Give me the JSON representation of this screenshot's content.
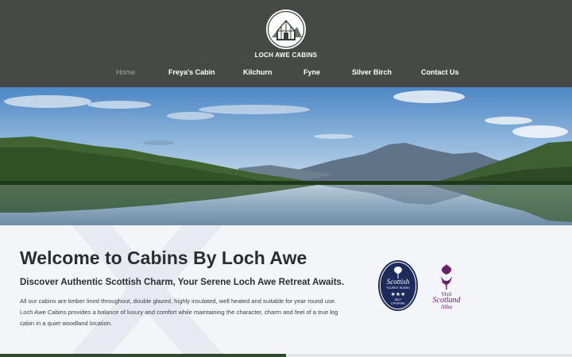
{
  "brand": {
    "name": "LOCH AWE CABINS",
    "logo_icon": "cabin-mountain-logo-icon"
  },
  "nav": {
    "items": [
      {
        "label": "Home",
        "active": true
      },
      {
        "label": "Freya's Cabin",
        "active": false
      },
      {
        "label": "Kilchurn",
        "active": false
      },
      {
        "label": "Fyne",
        "active": false
      },
      {
        "label": "Silver Birch",
        "active": false
      },
      {
        "label": "Contact Us",
        "active": false
      }
    ]
  },
  "hero": {
    "image": "loch-awe-landscape-photo"
  },
  "welcome": {
    "title": "Welcome to Cabins By Loch Awe",
    "subtitle": "Discover Authentic Scottish Charm, Your Serene Loch Awe Retreat Awaits.",
    "body": [
      "All our cabins are timber lined throughout, double glazed, highly insulated, well heated and suitable for year round use.",
      "Loch Awe Cabins provides a balance of luxury and comfort while maintaining the character, charm and feel of a true log",
      "cabin in a quiet woodland location."
    ]
  },
  "badges": {
    "tourist_board": {
      "line1": "Scottish",
      "line2": "TOURIST BOARD",
      "stars": "★★★",
      "line3": "SELF",
      "line4": "CATERING"
    },
    "visit_scotland": {
      "line1": "Visit",
      "line2": "Scotland",
      "line3": "Alba"
    }
  },
  "colors": {
    "header_bg": "#464a46",
    "nav_active": "#a6aaa6",
    "page_bg": "#f4f5f8",
    "title_text": "#2a2e33",
    "badge_navy": "#1d2a5c",
    "visit_purple": "#6b1f6e"
  }
}
